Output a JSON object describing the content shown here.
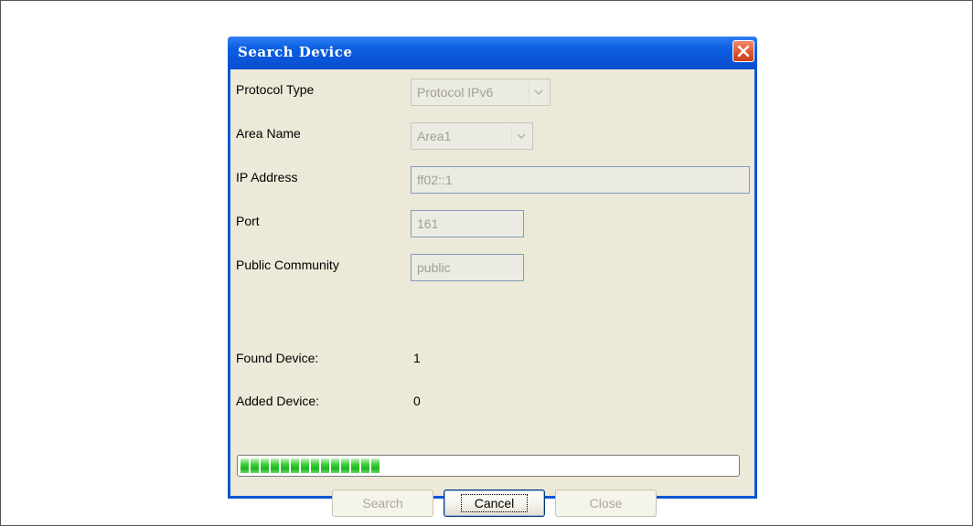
{
  "dialog": {
    "title": "Search Device",
    "close_icon": "close-icon"
  },
  "form": {
    "protocol_type": {
      "label": "Protocol Type",
      "value": "Protocol IPv6"
    },
    "area_name": {
      "label": "Area Name",
      "value": "Area1"
    },
    "ip_address": {
      "label": "IP Address",
      "value": "ff02::1"
    },
    "port": {
      "label": "Port",
      "value": "161"
    },
    "public_community": {
      "label": "Public Community",
      "value": "public"
    }
  },
  "stats": {
    "found_label": "Found Device:",
    "found_value": "1",
    "added_label": "Added Device:",
    "added_value": "0"
  },
  "progress": {
    "fraction": 0.29
  },
  "buttons": {
    "search": "Search",
    "cancel": "Cancel",
    "close": "Close"
  },
  "colors": {
    "titlebar": "#0a55d8",
    "client_bg": "#ece9d8",
    "progress_green": "#1db41d",
    "close_red": "#e25a35"
  }
}
